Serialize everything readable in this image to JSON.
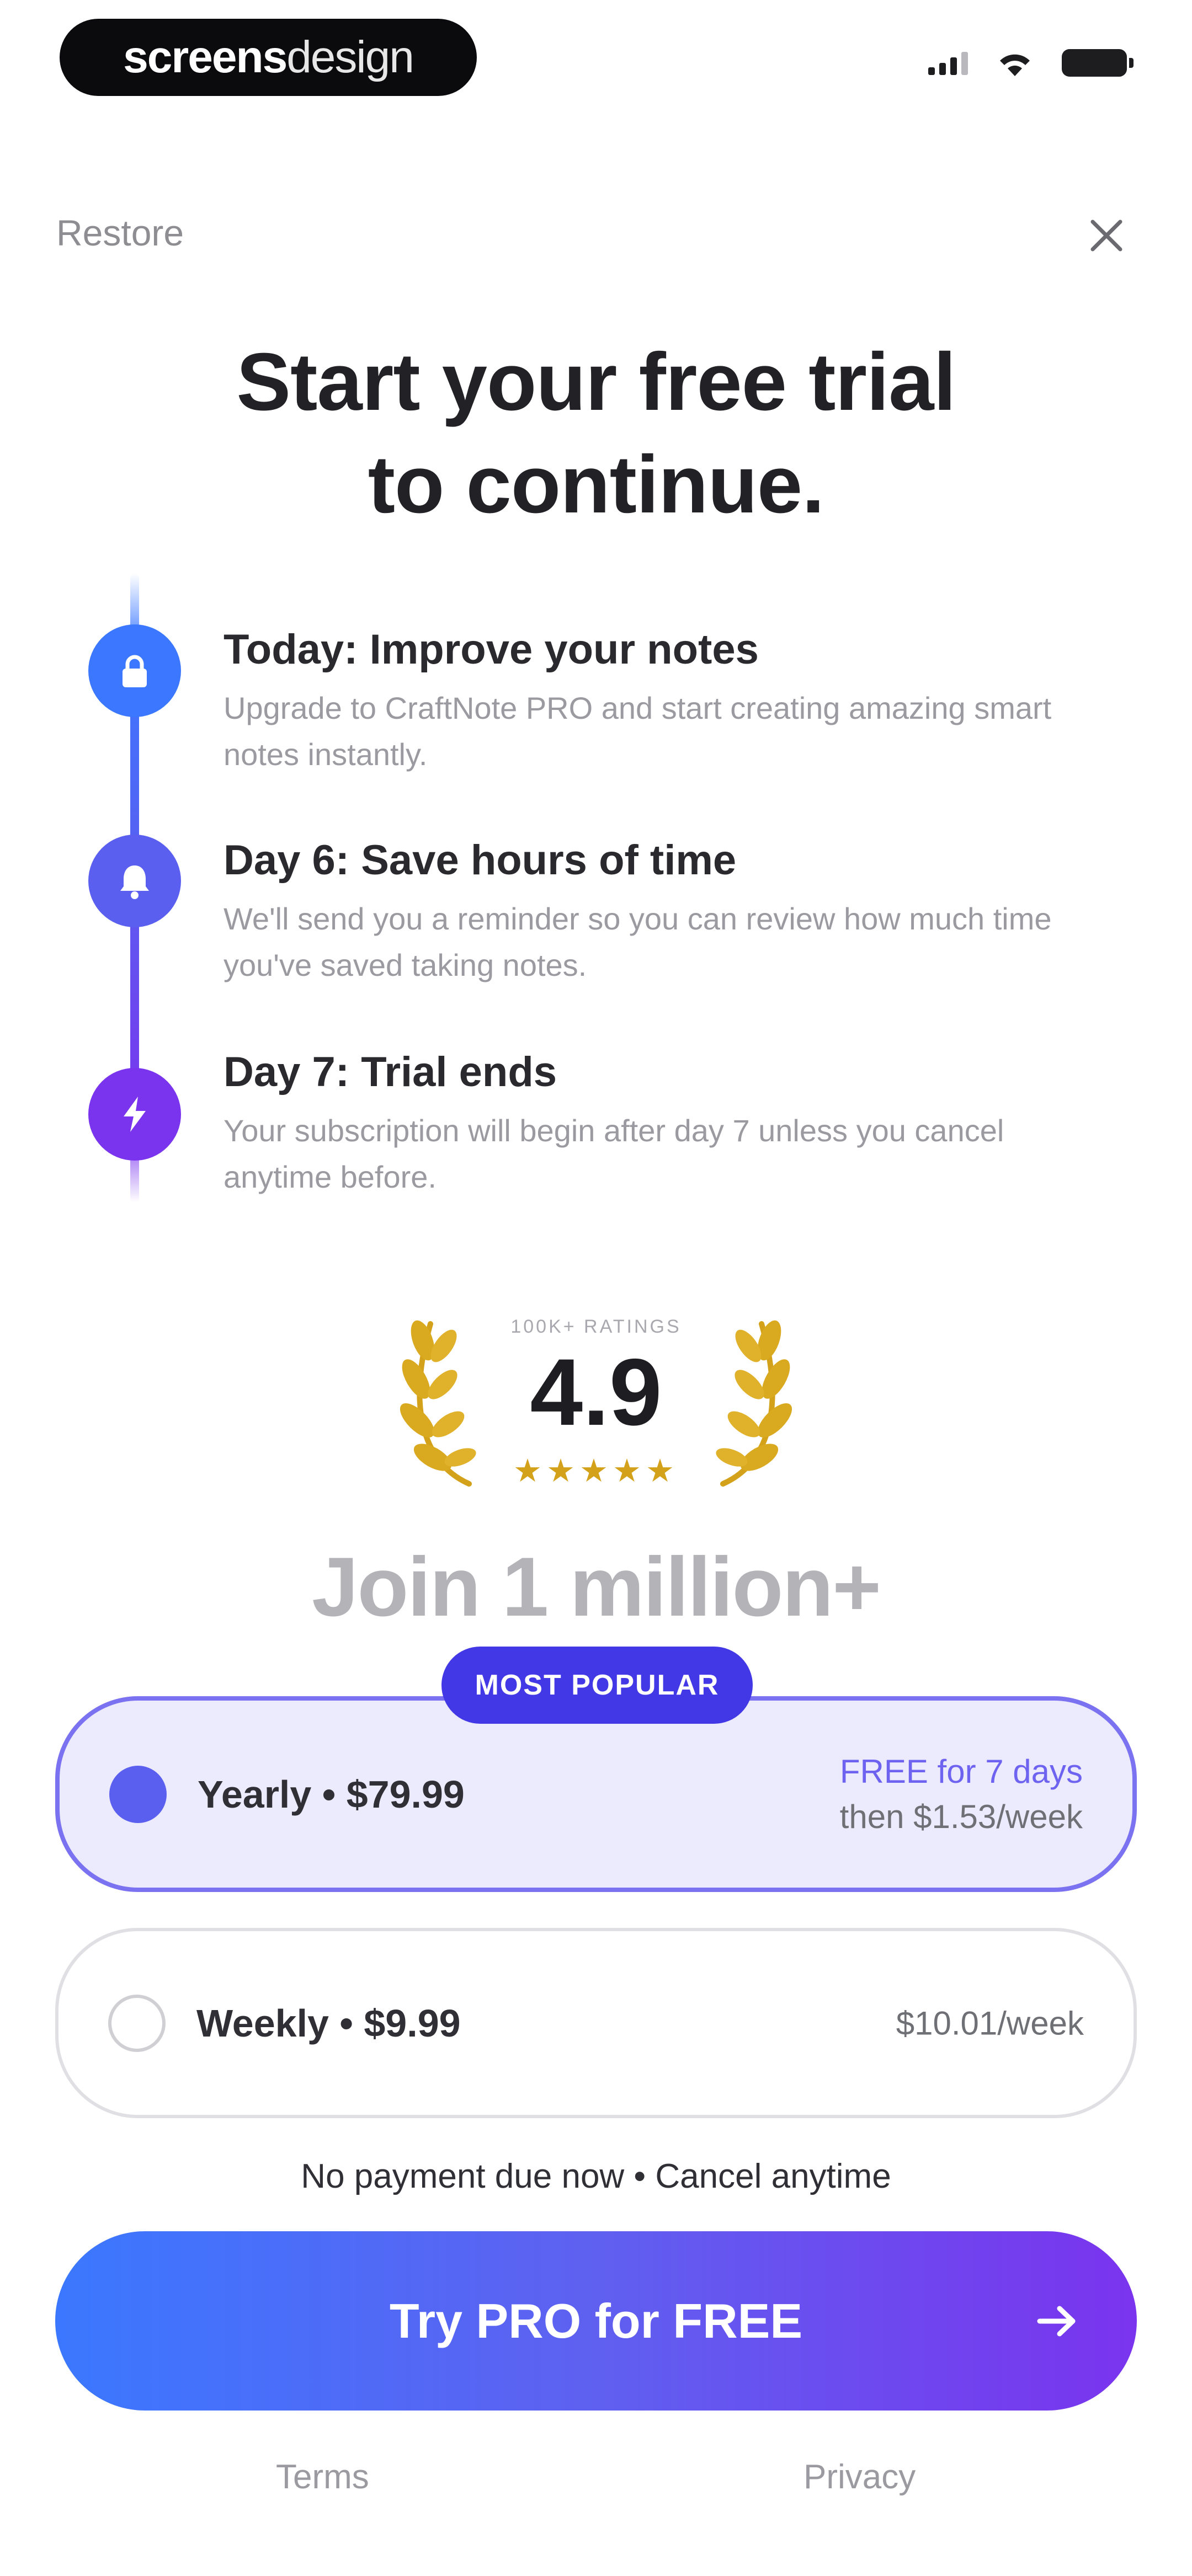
{
  "status_bar": {
    "brand_bold": "screens",
    "brand_light": "design",
    "icons": [
      "signal-icon",
      "wifi-icon",
      "battery-icon"
    ]
  },
  "header": {
    "restore_label": "Restore",
    "close_icon": "close-icon"
  },
  "title": {
    "line1": "Start your free trial",
    "line2": "to continue."
  },
  "timeline": [
    {
      "icon": "lock-icon",
      "heading": "Today: Improve your notes",
      "description": "Upgrade to CraftNote PRO and start creating amazing smart notes instantly."
    },
    {
      "icon": "bell-icon",
      "heading": "Day 6: Save hours of time",
      "description": "We'll send you a reminder so you can review how much time you've saved taking notes."
    },
    {
      "icon": "lightning-icon",
      "heading": "Day 7: Trial ends",
      "description": "Your subscription will begin after day 7 unless you cancel anytime before."
    }
  ],
  "rating": {
    "caption": "100K+ RATINGS",
    "value": "4.9",
    "stars": "★★★★★"
  },
  "join_text": "Join 1 million+",
  "plans": {
    "badge": "MOST POPULAR",
    "yearly": {
      "label": "Yearly • $79.99",
      "free_text": "FREE for 7 days",
      "then_text": "then $1.53/week",
      "selected": true
    },
    "weekly": {
      "label": "Weekly • $9.99",
      "price_text": "$10.01/week",
      "selected": false
    }
  },
  "note": "No payment due now • Cancel anytime",
  "cta": {
    "label": "Try PRO for FREE",
    "arrow_icon": "arrow-right-icon"
  },
  "footer": {
    "terms": "Terms",
    "privacy": "Privacy"
  },
  "colors": {
    "blue": "#3b78ff",
    "indigo": "#5b5ff0",
    "purple": "#7a34ee",
    "badge": "#4338e6",
    "gold": "#d3a21a"
  }
}
